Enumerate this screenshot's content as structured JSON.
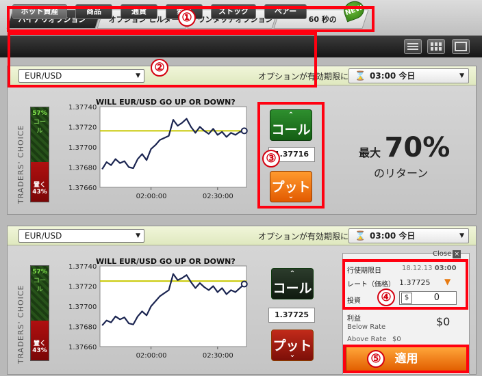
{
  "top_tabs": [
    {
      "label": "バイナリオプション",
      "active": true
    },
    {
      "label": "オプション ビルダー",
      "active": false
    },
    {
      "label": "ワンタッチオプション",
      "active": false
    },
    {
      "label": "60 秒の",
      "active": false
    }
  ],
  "new_badge": "NEW",
  "markers": [
    "①",
    "②",
    "③",
    "④",
    "⑤"
  ],
  "categories": [
    {
      "label": "ホット資産",
      "active": true
    },
    {
      "label": "商品",
      "active": false
    },
    {
      "label": "通貨",
      "active": false
    },
    {
      "label": "索引",
      "active": false
    },
    {
      "label": "ストック",
      "active": false
    },
    {
      "label": "ペアー",
      "active": false
    }
  ],
  "panels": [
    {
      "asset": "EUR/USD",
      "expiry_label": "オプションが有効期限に",
      "expiry_value": "03:00 今日",
      "traders_choice": "TRADERS' CHOICE",
      "call_pct": "57%",
      "call_text": "コール",
      "put_text": "置く",
      "put_pct": "43%",
      "chart_title": "WILL EUR/USD GO UP OR DOWN?",
      "call_label": "コール",
      "put_label": "プット",
      "price": "1.37716",
      "return_prefix": "最大",
      "return_pct": "70%",
      "return_suffix": "のリターン"
    },
    {
      "asset": "EUR/USD",
      "expiry_label": "オプションが有効期限に",
      "expiry_value": "03:00 今日",
      "traders_choice": "TRADERS' CHOICE",
      "call_pct": "57%",
      "call_text": "コール",
      "put_text": "置く",
      "put_pct": "43%",
      "chart_title": "WILL EUR/USD GO UP OR DOWN?",
      "call_label": "コール",
      "put_label": "プット",
      "price": "1.37725"
    }
  ],
  "ticket": {
    "close": "Close",
    "expiry_label": "行使期限日",
    "expiry_date": "18.12.13",
    "expiry_time": "03:00",
    "rate_label": "レート（価格）",
    "rate_value": "1.37725",
    "invest_label": "投資",
    "currency": "$",
    "invest_value": "0",
    "profit_label": "利益",
    "below_rate": "Below Rate",
    "profit_value": "$0",
    "above_rate": "Above Rate",
    "above_value": "$0",
    "apply_label": "適用"
  },
  "chart_data": [
    {
      "type": "line",
      "title": "WILL EUR/USD GO UP OR DOWN?",
      "xlabel": "",
      "ylabel": "",
      "y_ticks": [
        "1.37740",
        "1.37720",
        "1.37700",
        "1.37680",
        "1.37660"
      ],
      "x_ticks": [
        "02:00:00",
        "02:30:00"
      ],
      "ylim": [
        1.3766,
        1.3774
      ],
      "xlim": [
        "01:37",
        "02:43"
      ],
      "target_rate": 1.37716,
      "series": [
        {
          "x": [
            "01:38",
            "01:40",
            "01:42",
            "01:44",
            "01:46",
            "01:48",
            "01:50",
            "01:52",
            "01:54",
            "01:56",
            "01:58",
            "02:00",
            "02:02",
            "02:04",
            "02:06",
            "02:08",
            "02:10",
            "02:12",
            "02:14",
            "02:16",
            "02:18",
            "02:20",
            "02:22",
            "02:24",
            "02:26",
            "02:28",
            "02:30",
            "02:32",
            "02:34",
            "02:36",
            "02:38",
            "02:40",
            "02:42"
          ],
          "values": [
            1.37678,
            1.37685,
            1.37682,
            1.37688,
            1.37684,
            1.37686,
            1.3768,
            1.37679,
            1.37688,
            1.37693,
            1.37687,
            1.37698,
            1.37702,
            1.37707,
            1.37709,
            1.37711,
            1.37727,
            1.37721,
            1.37724,
            1.37728,
            1.3772,
            1.37714,
            1.3772,
            1.37716,
            1.37713,
            1.37718,
            1.37712,
            1.37715,
            1.3771,
            1.37714,
            1.37712,
            1.37715,
            1.37716
          ]
        }
      ]
    },
    {
      "type": "line",
      "title": "WILL EUR/USD GO UP OR DOWN?",
      "xlabel": "",
      "ylabel": "",
      "y_ticks": [
        "1.37740",
        "1.37720",
        "1.37700",
        "1.37680",
        "1.37660"
      ],
      "x_ticks": [
        "02:00:00",
        "02:30:00"
      ],
      "ylim": [
        1.3766,
        1.3774
      ],
      "xlim": [
        "01:37",
        "02:43"
      ],
      "target_rate": 1.37725,
      "series": [
        {
          "x": [
            "01:38",
            "01:40",
            "01:42",
            "01:44",
            "01:46",
            "01:48",
            "01:50",
            "01:52",
            "01:54",
            "01:56",
            "01:58",
            "02:00",
            "02:02",
            "02:04",
            "02:06",
            "02:08",
            "02:10",
            "02:12",
            "02:14",
            "02:16",
            "02:18",
            "02:20",
            "02:22",
            "02:24",
            "02:26",
            "02:28",
            "02:30",
            "02:32",
            "02:34",
            "02:36",
            "02:38",
            "02:40",
            "02:42"
          ],
          "values": [
            1.37681,
            1.37686,
            1.37684,
            1.3769,
            1.37687,
            1.37689,
            1.37683,
            1.37682,
            1.3769,
            1.37695,
            1.37691,
            1.377,
            1.37705,
            1.3771,
            1.37713,
            1.37716,
            1.37732,
            1.37726,
            1.37728,
            1.37731,
            1.37724,
            1.37718,
            1.37723,
            1.37719,
            1.37716,
            1.3772,
            1.37714,
            1.37718,
            1.37712,
            1.37716,
            1.37714,
            1.37718,
            1.37722
          ]
        }
      ]
    }
  ],
  "colors": {
    "accent_red": "#ff0010",
    "call_green": "#1f7a1f",
    "put_orange": "#f07a10",
    "target_line": "#c8c800",
    "price_line": "#1a2450"
  }
}
